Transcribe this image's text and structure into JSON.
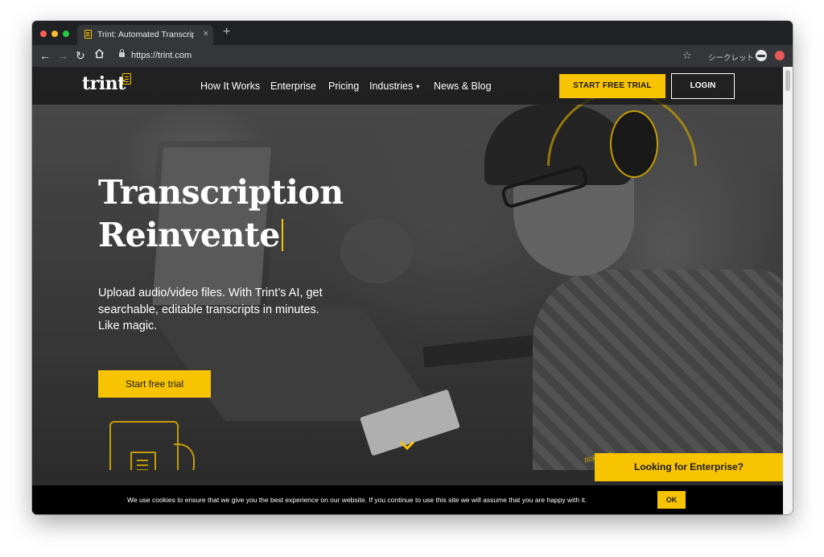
{
  "browser": {
    "tab_title": "Trint: Automated Transcription",
    "tab_close": "×",
    "new_tab": "+",
    "url": "https://trint.com",
    "incognito_label": "シークレット",
    "icons": [
      "back-arrow-icon",
      "forward-arrow-icon",
      "reload-icon",
      "home-icon",
      "lock-icon",
      "star-icon",
      "incognito-icon",
      "extension-icon"
    ]
  },
  "site": {
    "logo": "trint",
    "nav": {
      "items": [
        {
          "label": "How It Works"
        },
        {
          "label": "Enterprise"
        },
        {
          "label": "Pricing"
        },
        {
          "label": "Industries"
        },
        {
          "label": "News & Blog"
        }
      ],
      "industries_caret": "▾",
      "start_trial": "START FREE TRIAL",
      "login": "LOGIN"
    },
    "hero": {
      "title_line1": "Transcription",
      "title_line2": "Reinvente",
      "subtitle": "Upload audio/video files. With Trint’s AI, get searchable, editable transcripts in minutes. Like magic.",
      "cta": "Start free trial",
      "doodle_text": "tick tock"
    },
    "enterprise_button": "Looking for Enterprise?",
    "cookie": {
      "text": "We use cookies to ensure that we give you the best experience on our website. If you continue to use this site we will assume that you are happy with it.",
      "ok": "OK"
    }
  },
  "colors": {
    "accent": "#f8c300",
    "nav_bg": "#121212",
    "cookie_bg": "#000000",
    "chrome_bg": "#202124"
  }
}
